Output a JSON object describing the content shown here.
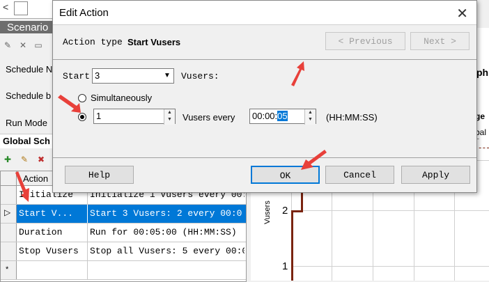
{
  "background": {
    "scenario_header": "Scenario",
    "schedule_name_label": "Schedule N",
    "schedule_by_label": "Schedule b",
    "run_mode_label": "Run Mode",
    "global_schedule_label": "Global Sch",
    "grid": {
      "header_action": "Action",
      "rows": [
        {
          "action": "Initialize",
          "properties": "Initialize 1 Vusers every 00:0"
        },
        {
          "action": "Start  V...",
          "properties": "Start 3 Vusers: 2 every 00:0",
          "selected": true
        },
        {
          "action": "Duration",
          "properties": "Run for 00:05:00 (HH:MM:SS)"
        },
        {
          "action": "Stop Vusers",
          "properties": "Stop all Vusers: 5 every 00:0"
        }
      ],
      "new_row_marker": "*"
    },
    "graph": {
      "y_label": "Vusers",
      "ticks": [
        "2",
        "1"
      ]
    },
    "right_fragments": [
      "ph",
      "ge",
      "bal S"
    ]
  },
  "dialog": {
    "title": "Edit Action",
    "action_type_prefix": "Action type",
    "action_type_value": "Start Vusers",
    "previous_label": "<  Previous",
    "next_label": "Next  >",
    "start_label": "Start",
    "start_value": "3",
    "vusers_label": "Vusers:",
    "simultaneously_label": "Simultaneously",
    "count_value": "1",
    "vusers_every_label": "Vusers every",
    "time_prefix": "00:00:",
    "time_seconds": "05",
    "time_format": "(HH:MM:SS)",
    "help_label": "Help",
    "ok_label": "OK",
    "cancel_label": "Cancel",
    "apply_label": "Apply"
  },
  "colors": {
    "selection": "#0078d7",
    "arrow": "#e8403a",
    "graph_line": "#7a2410"
  }
}
